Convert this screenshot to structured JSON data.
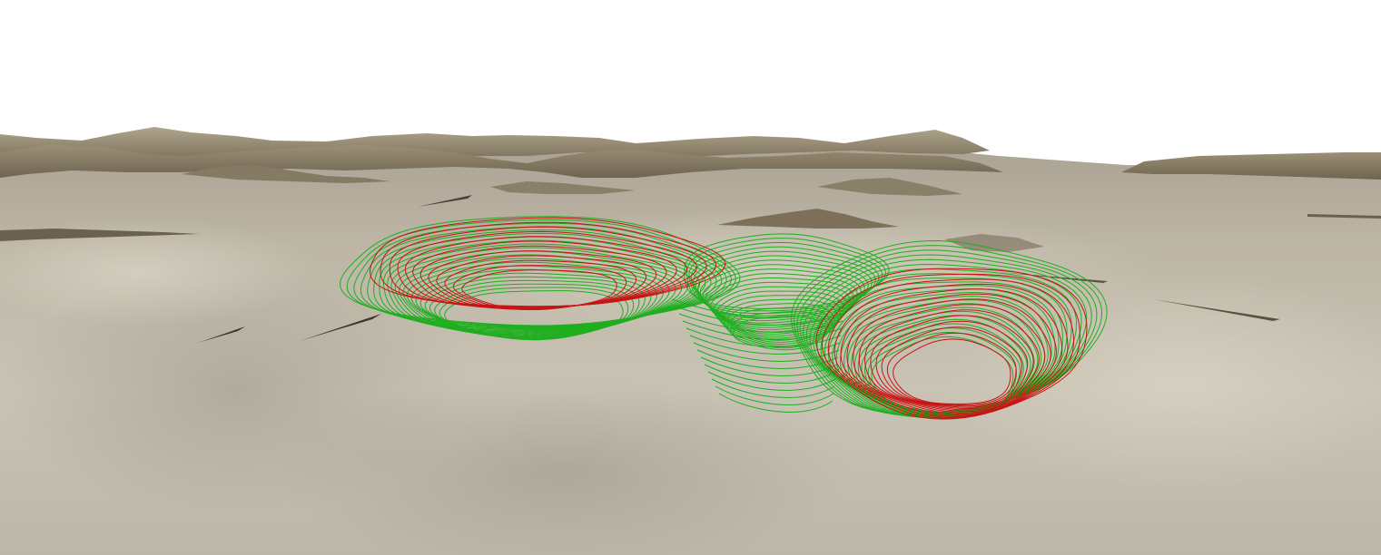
{
  "viewer": {
    "background_color": "#ffffff",
    "terrain": {
      "near_color": "#c2bcad",
      "far_color": "#8d8069",
      "ridge_color": "#6f6450",
      "shadow_color": "#514838"
    },
    "design_contours": {
      "color": "#1fae1f",
      "description_label": ""
    },
    "pit_shells": {
      "color": "#c81414",
      "count": 2
    }
  }
}
